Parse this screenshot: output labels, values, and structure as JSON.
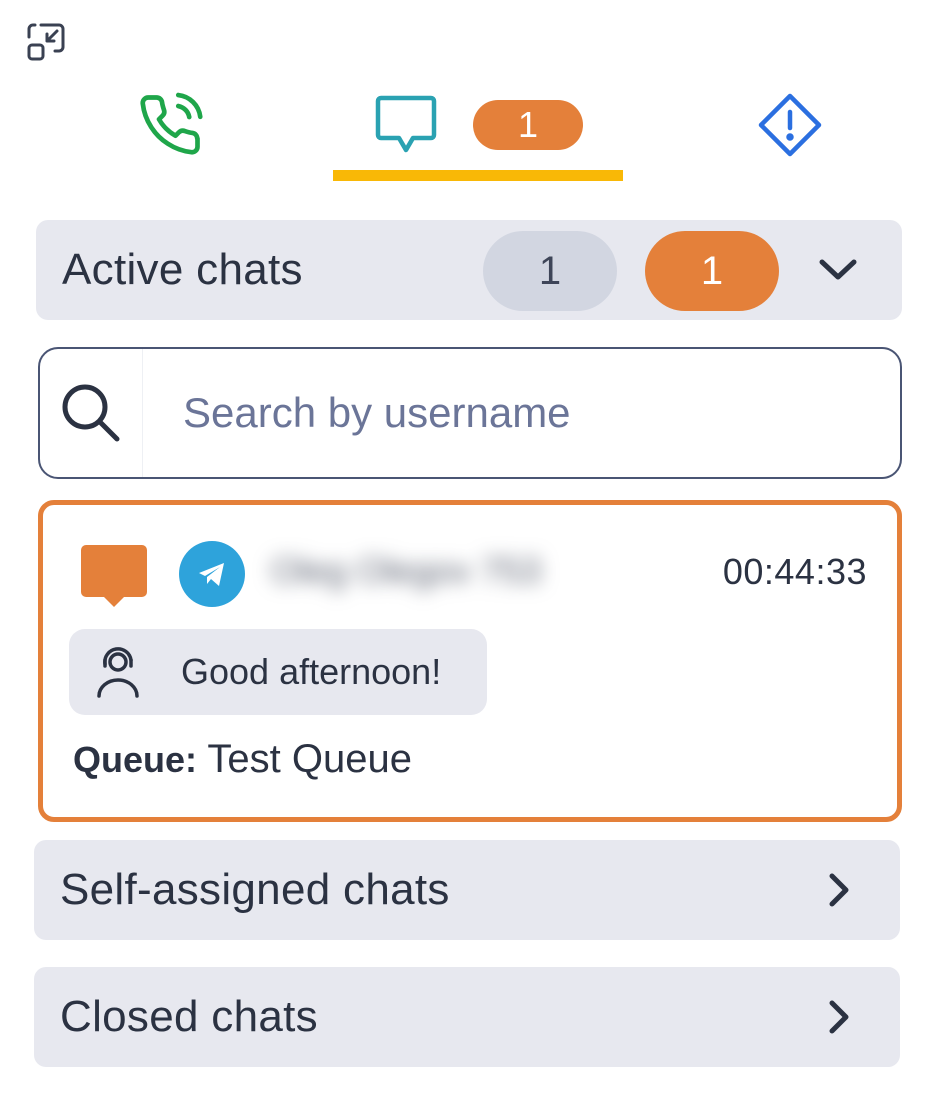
{
  "tabs": {
    "chat_badge": "1"
  },
  "active_chats": {
    "title": "Active chats",
    "total_count": "1",
    "unread_count": "1"
  },
  "search": {
    "placeholder": "Search by username"
  },
  "chat_card": {
    "username": "Oleg Olegov 753",
    "timer": "00:44:33",
    "last_message": "Good afternoon!",
    "queue_label": "Queue:",
    "queue_name": "Test Queue"
  },
  "self_assigned": {
    "title": "Self-assigned chats"
  },
  "closed": {
    "title": "Closed chats"
  },
  "colors": {
    "accent_orange": "#e4803a",
    "tab_underline": "#f9b806",
    "phone_green": "#1fa64a",
    "chat_teal": "#2aa2b2",
    "alert_blue": "#2b6fe0",
    "telegram_blue": "#2ea3db"
  }
}
